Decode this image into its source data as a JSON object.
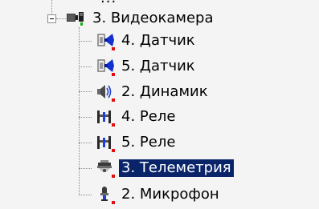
{
  "top_partial_text": "...",
  "tree": {
    "root": {
      "label": "3. Видеокамера",
      "icon": "video-camera-icon",
      "expanded": true,
      "children": [
        {
          "label": "4. Датчик",
          "icon": "sensor-icon",
          "selected": false
        },
        {
          "label": "5. Датчик",
          "icon": "sensor-icon",
          "selected": false
        },
        {
          "label": "2. Динамик",
          "icon": "speaker-icon",
          "selected": false
        },
        {
          "label": "4. Реле",
          "icon": "relay-icon",
          "selected": false
        },
        {
          "label": "5. Реле",
          "icon": "relay-icon",
          "selected": false
        },
        {
          "label": "3. Телеметрия",
          "icon": "telemetry-camera-icon",
          "selected": true
        },
        {
          "label": "2. Микрофон",
          "icon": "microphone-icon",
          "selected": false
        }
      ]
    }
  },
  "colors": {
    "selection_bg": "#0a246a",
    "selection_text": "#ffffff",
    "status_marker": "#e01010"
  }
}
